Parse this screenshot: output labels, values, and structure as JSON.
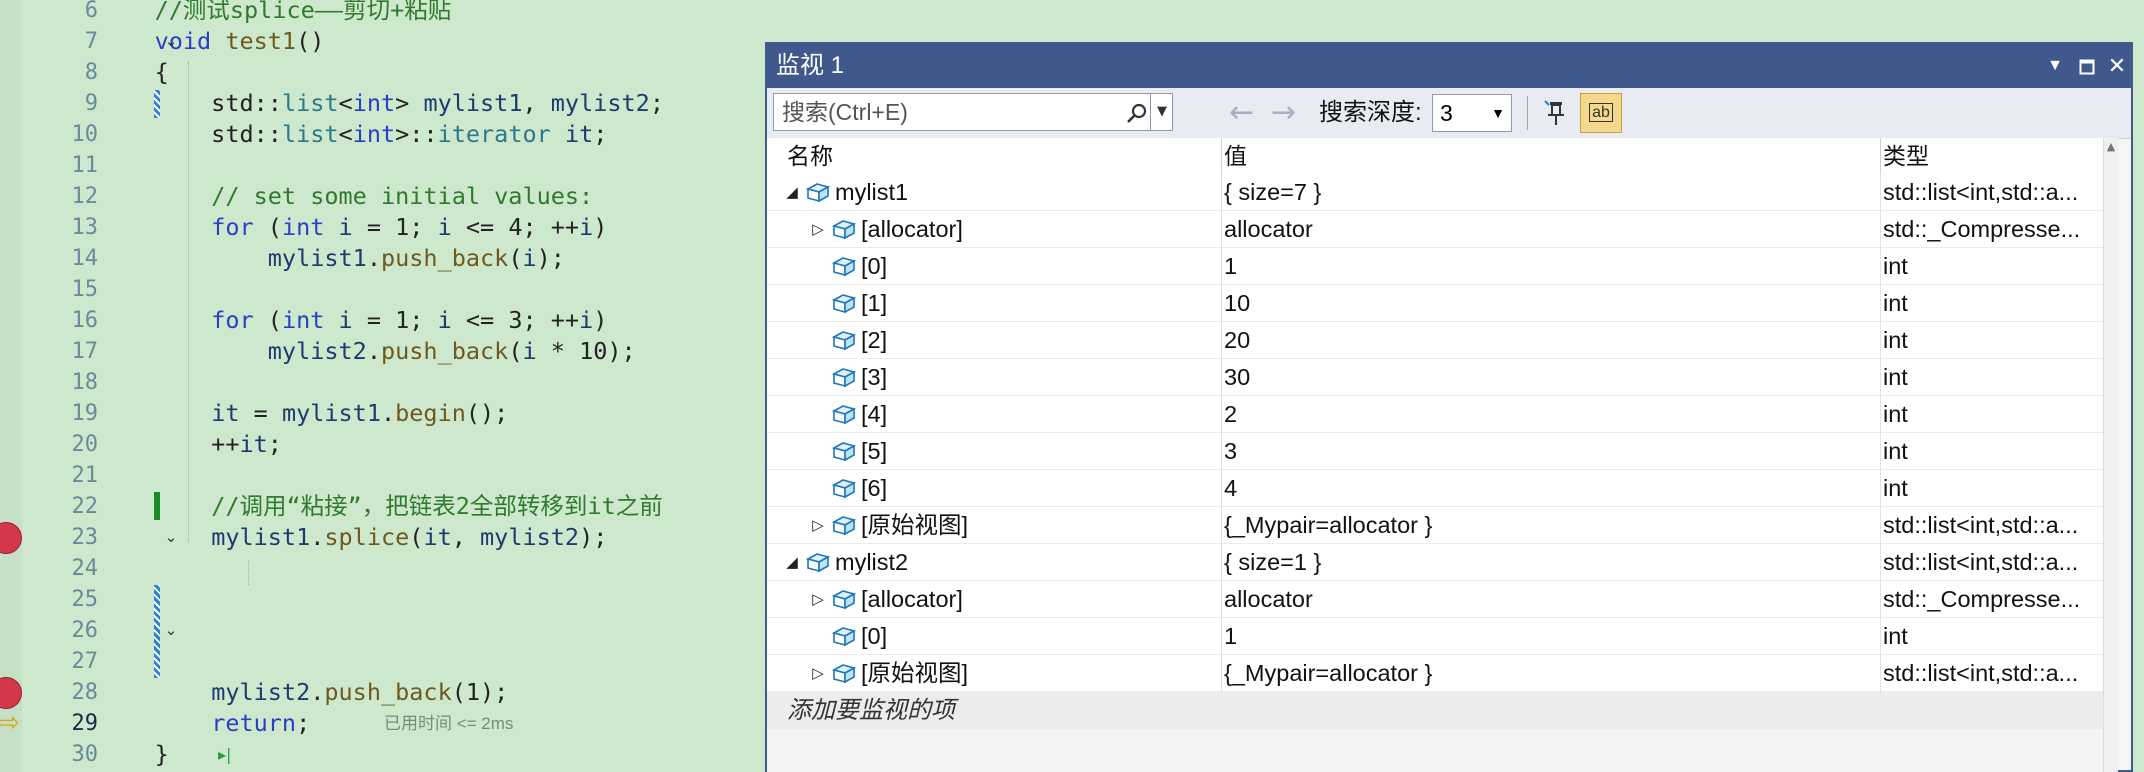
{
  "editor": {
    "lines": [
      {
        "n": "6",
        "parts": [
          {
            "t": "    ",
            "c": ""
          },
          {
            "t": "//测试splice——剪切+粘贴",
            "c": "cm"
          }
        ]
      },
      {
        "n": "7",
        "parts": [
          {
            "t": "    ",
            "c": ""
          },
          {
            "t": "void",
            "c": "kw"
          },
          {
            "t": " ",
            "c": ""
          },
          {
            "t": "test1",
            "c": "fn"
          },
          {
            "t": "()",
            "c": ""
          }
        ]
      },
      {
        "n": "8",
        "parts": [
          {
            "t": "    {",
            "c": ""
          }
        ]
      },
      {
        "n": "9",
        "parts": [
          {
            "t": "        std::",
            "c": ""
          },
          {
            "t": "list",
            "c": "ty"
          },
          {
            "t": "<",
            "c": ""
          },
          {
            "t": "int",
            "c": "kw"
          },
          {
            "t": "> ",
            "c": ""
          },
          {
            "t": "mylist1",
            "c": "var"
          },
          {
            "t": ", ",
            "c": ""
          },
          {
            "t": "mylist2",
            "c": "var"
          },
          {
            "t": ";",
            "c": ""
          }
        ]
      },
      {
        "n": "10",
        "parts": [
          {
            "t": "        std::",
            "c": ""
          },
          {
            "t": "list",
            "c": "ty"
          },
          {
            "t": "<",
            "c": ""
          },
          {
            "t": "int",
            "c": "kw"
          },
          {
            "t": ">::",
            "c": ""
          },
          {
            "t": "iterator",
            "c": "ty"
          },
          {
            "t": " ",
            "c": ""
          },
          {
            "t": "it",
            "c": "var"
          },
          {
            "t": ";",
            "c": ""
          }
        ]
      },
      {
        "n": "11",
        "parts": [
          {
            "t": "",
            "c": ""
          }
        ]
      },
      {
        "n": "12",
        "parts": [
          {
            "t": "        ",
            "c": ""
          },
          {
            "t": "// set some initial values:",
            "c": "cm"
          }
        ]
      },
      {
        "n": "13",
        "parts": [
          {
            "t": "        ",
            "c": ""
          },
          {
            "t": "for",
            "c": "kw"
          },
          {
            "t": " (",
            "c": ""
          },
          {
            "t": "int",
            "c": "kw"
          },
          {
            "t": " ",
            "c": ""
          },
          {
            "t": "i",
            "c": "var"
          },
          {
            "t": " = 1; ",
            "c": ""
          },
          {
            "t": "i",
            "c": "var"
          },
          {
            "t": " <= 4; ++",
            "c": ""
          },
          {
            "t": "i",
            "c": "var"
          },
          {
            "t": ")",
            "c": ""
          }
        ]
      },
      {
        "n": "14",
        "parts": [
          {
            "t": "            ",
            "c": ""
          },
          {
            "t": "mylist1",
            "c": "var"
          },
          {
            "t": ".",
            "c": ""
          },
          {
            "t": "push_back",
            "c": "fn"
          },
          {
            "t": "(",
            "c": ""
          },
          {
            "t": "i",
            "c": "var"
          },
          {
            "t": ");",
            "c": ""
          }
        ]
      },
      {
        "n": "15",
        "parts": [
          {
            "t": "",
            "c": ""
          }
        ]
      },
      {
        "n": "16",
        "parts": [
          {
            "t": "        ",
            "c": ""
          },
          {
            "t": "for",
            "c": "kw"
          },
          {
            "t": " (",
            "c": ""
          },
          {
            "t": "int",
            "c": "kw"
          },
          {
            "t": " ",
            "c": ""
          },
          {
            "t": "i",
            "c": "var"
          },
          {
            "t": " = 1; ",
            "c": ""
          },
          {
            "t": "i",
            "c": "var"
          },
          {
            "t": " <= 3; ++",
            "c": ""
          },
          {
            "t": "i",
            "c": "var"
          },
          {
            "t": ")",
            "c": ""
          }
        ]
      },
      {
        "n": "17",
        "parts": [
          {
            "t": "            ",
            "c": ""
          },
          {
            "t": "mylist2",
            "c": "var"
          },
          {
            "t": ".",
            "c": ""
          },
          {
            "t": "push_back",
            "c": "fn"
          },
          {
            "t": "(",
            "c": ""
          },
          {
            "t": "i",
            "c": "var"
          },
          {
            "t": " * 10);",
            "c": ""
          }
        ]
      },
      {
        "n": "18",
        "parts": [
          {
            "t": "",
            "c": ""
          }
        ]
      },
      {
        "n": "19",
        "parts": [
          {
            "t": "        ",
            "c": ""
          },
          {
            "t": "it",
            "c": "var"
          },
          {
            "t": " = ",
            "c": ""
          },
          {
            "t": "mylist1",
            "c": "var"
          },
          {
            "t": ".",
            "c": ""
          },
          {
            "t": "begin",
            "c": "fn"
          },
          {
            "t": "();",
            "c": ""
          }
        ]
      },
      {
        "n": "20",
        "parts": [
          {
            "t": "        ++",
            "c": ""
          },
          {
            "t": "it",
            "c": "var"
          },
          {
            "t": ";",
            "c": ""
          }
        ]
      },
      {
        "n": "21",
        "parts": [
          {
            "t": "",
            "c": ""
          }
        ]
      },
      {
        "n": "22",
        "parts": [
          {
            "t": "        ",
            "c": ""
          },
          {
            "t": "//调用“粘接”，把链表2全部转移到it之前",
            "c": "cm"
          }
        ]
      },
      {
        "n": "23",
        "parts": [
          {
            "t": "        ",
            "c": ""
          },
          {
            "t": "mylist1",
            "c": "var"
          },
          {
            "t": ".",
            "c": ""
          },
          {
            "t": "splice",
            "c": "fn"
          },
          {
            "t": "(",
            "c": ""
          },
          {
            "t": "it",
            "c": "var"
          },
          {
            "t": ", ",
            "c": ""
          },
          {
            "t": "mylist2",
            "c": "var"
          },
          {
            "t": ");",
            "c": ""
          }
        ]
      },
      {
        "n": "24",
        "parts": [
          {
            "t": "",
            "c": ""
          }
        ]
      },
      {
        "n": "25",
        "parts": [
          {
            "t": "",
            "c": ""
          }
        ]
      },
      {
        "n": "26",
        "parts": [
          {
            "t": "",
            "c": ""
          }
        ]
      },
      {
        "n": "27",
        "parts": [
          {
            "t": "",
            "c": ""
          }
        ]
      },
      {
        "n": "28",
        "parts": [
          {
            "t": "        ",
            "c": ""
          },
          {
            "t": "mylist2",
            "c": "var"
          },
          {
            "t": ".",
            "c": ""
          },
          {
            "t": "push_back",
            "c": "fn"
          },
          {
            "t": "(1);",
            "c": ""
          }
        ]
      },
      {
        "n": "29",
        "parts": [
          {
            "t": "        ",
            "c": ""
          },
          {
            "t": "return",
            "c": "kw"
          },
          {
            "t": ";",
            "c": ""
          }
        ]
      },
      {
        "n": "30",
        "parts": [
          {
            "t": "    }",
            "c": ""
          }
        ]
      }
    ],
    "elapsed_hint": "已用时间 <= 2ms",
    "breakpoint_lines": [
      "23",
      "28"
    ],
    "current_line": "29"
  },
  "watch": {
    "title": "监视 1",
    "search_placeholder": "搜索(Ctrl+E)",
    "depth_label": "搜索深度:",
    "depth_value": "3",
    "hex_label": "ab",
    "columns": {
      "name": "名称",
      "value": "值",
      "type": "类型"
    },
    "rows": [
      {
        "level": 0,
        "expand": "expanded",
        "name": "mylist1",
        "value": "{ size=7 }",
        "type": "std::list<int,std::a..."
      },
      {
        "level": 1,
        "expand": "collapsed",
        "name": "[allocator]",
        "value": "allocator",
        "type": "std::_Compresse..."
      },
      {
        "level": 1,
        "expand": "none",
        "name": "[0]",
        "value": "1",
        "type": "int"
      },
      {
        "level": 1,
        "expand": "none",
        "name": "[1]",
        "value": "10",
        "type": "int"
      },
      {
        "level": 1,
        "expand": "none",
        "name": "[2]",
        "value": "20",
        "type": "int"
      },
      {
        "level": 1,
        "expand": "none",
        "name": "[3]",
        "value": "30",
        "type": "int"
      },
      {
        "level": 1,
        "expand": "none",
        "name": "[4]",
        "value": "2",
        "type": "int"
      },
      {
        "level": 1,
        "expand": "none",
        "name": "[5]",
        "value": "3",
        "type": "int"
      },
      {
        "level": 1,
        "expand": "none",
        "name": "[6]",
        "value": "4",
        "type": "int"
      },
      {
        "level": 1,
        "expand": "collapsed",
        "name": "[原始视图]",
        "value": "{_Mypair=allocator }",
        "type": "std::list<int,std::a..."
      },
      {
        "level": 0,
        "expand": "expanded",
        "name": "mylist2",
        "value": "{ size=1 }",
        "type": "std::list<int,std::a..."
      },
      {
        "level": 1,
        "expand": "collapsed",
        "name": "[allocator]",
        "value": "allocator",
        "type": "std::_Compresse..."
      },
      {
        "level": 1,
        "expand": "none",
        "name": "[0]",
        "value": "1",
        "type": "int"
      },
      {
        "level": 1,
        "expand": "collapsed",
        "name": "[原始视图]",
        "value": "{_Mypair=allocator }",
        "type": "std::list<int,std::a..."
      }
    ],
    "add_watch_label": "添加要监视的项"
  },
  "icons": {
    "title_dropdown": "chevron-down-icon",
    "maximize": "maximize-icon",
    "close": "close-icon",
    "search": "search-icon",
    "back": "arrow-left-icon",
    "forward": "arrow-right-icon",
    "pin": "pin-icon",
    "object": "object-cube-icon"
  },
  "colors": {
    "editor_bg": "#cde8cd",
    "title_bar": "#41588c",
    "breakpoint": "#d2374a",
    "keyword": "#2a3fc4",
    "comment": "#2f7a2f"
  }
}
